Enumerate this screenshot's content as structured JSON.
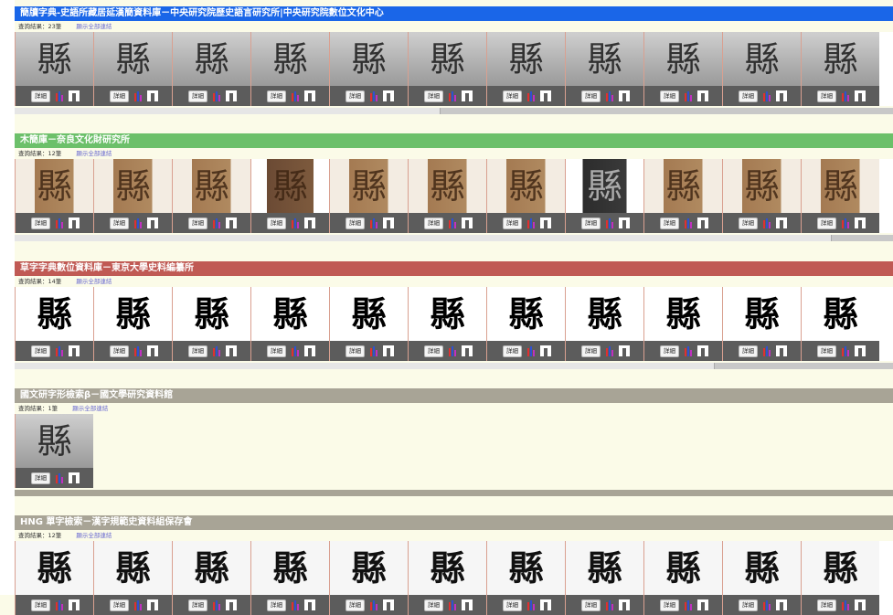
{
  "sections": [
    {
      "title": "簡牘字典-史語所藏居延漢簡資料庫－中央研究院歷史語言研究所|中央研究院數位文化中心",
      "count_label": "查詢結果：23筆",
      "show_all_label": "顯示全部連結",
      "glyph": "縣",
      "thumb_style": "photo",
      "tiles": 11
    },
    {
      "title": "木簡庫－奈良文化財研究所",
      "count_label": "查詢結果：12筆",
      "show_all_label": "顯示全部連結",
      "glyph": "縣",
      "thumb_style": "wood",
      "tiles": 11
    },
    {
      "title": "草字字典數位資料庫－東京大學史料編纂所",
      "count_label": "查詢結果：14筆",
      "show_all_label": "顯示全部連結",
      "glyph": "縣",
      "thumb_style": "ink",
      "tiles": 11
    },
    {
      "title": "國文研字形檢索β－國文學研究資料館",
      "count_label": "查詢結果：1筆",
      "show_all_label": "顯示全部連結",
      "glyph": "縣",
      "thumb_style": "photo",
      "tiles": 1
    },
    {
      "title": "HNG 單字檢索－漢字規範史資料組保存會",
      "count_label": "查詢結果：12筆",
      "show_all_label": "顯示全部連結",
      "glyph": "縣",
      "thumb_style": "print",
      "tiles": 11
    }
  ],
  "detail_label": "詳細",
  "colors": {
    "section1": "#1a66e8",
    "section2": "#6cc06a",
    "section3": "#c05a54",
    "section4": "#a8a496",
    "section5": "#a8a496",
    "background": "#fbfbe8"
  },
  "icons": [
    "color-bar-icon",
    "iiif-viewer-icon"
  ]
}
